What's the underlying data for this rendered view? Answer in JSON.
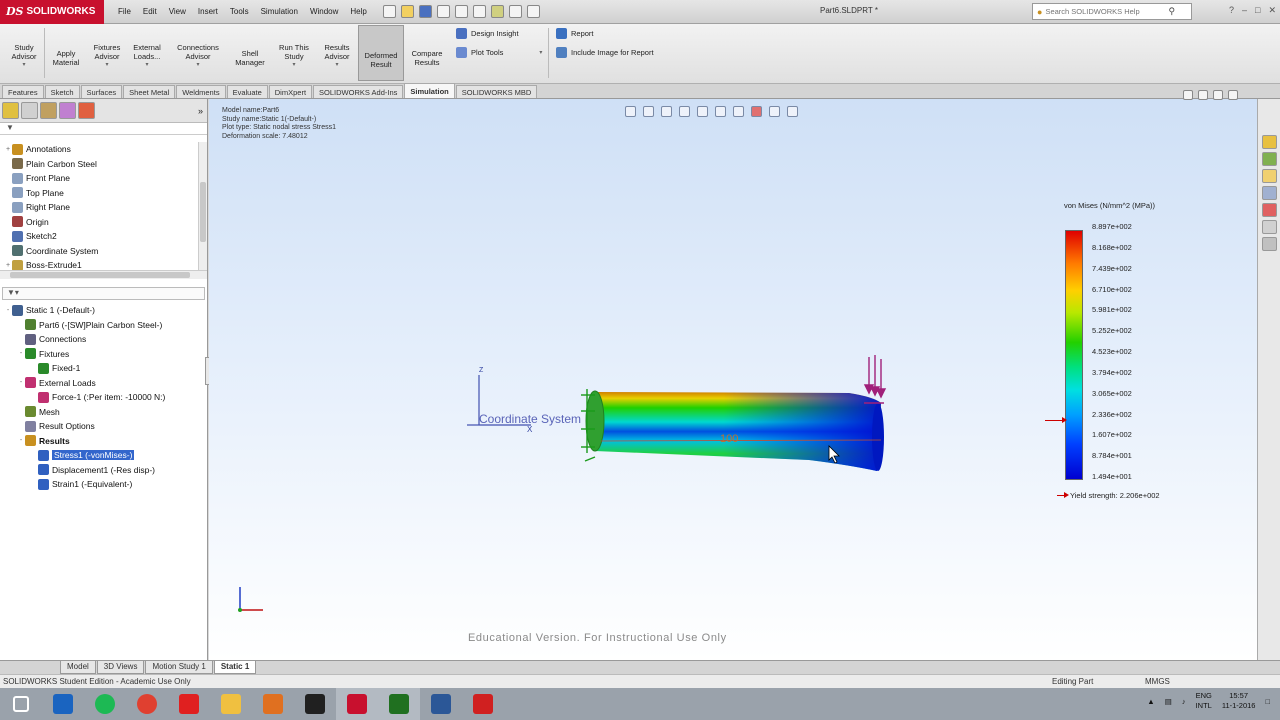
{
  "app": {
    "brand": "SOLIDWORKS",
    "brand_mark": "DS",
    "document_title": "Part6.SLDPRT *",
    "search_placeholder": "Search SOLIDWORKS Help"
  },
  "menu": [
    "File",
    "Edit",
    "View",
    "Insert",
    "Tools",
    "Simulation",
    "Window",
    "Help"
  ],
  "command_manager": {
    "buttons": [
      {
        "label": "Study\nAdvisor",
        "color": "#e0a020"
      },
      {
        "label": "Apply\nMaterial",
        "color": "#8a6a3a"
      },
      {
        "label": "Fixtures\nAdvisor",
        "color": "#2a8a2a"
      },
      {
        "label": "External\nLoads...",
        "color": "#c03070"
      },
      {
        "label": "Connections\nAdvisor",
        "color": "#4a6ab0"
      },
      {
        "label": "Shell\nManager",
        "color": "#3a9ad0"
      },
      {
        "label": "Run This\nStudy",
        "color": "#d04020"
      },
      {
        "label": "Results\nAdvisor",
        "color": "#2a8a8a"
      },
      {
        "label": "Deformed\nResult",
        "color": "#3060c0"
      },
      {
        "label": "Compare\nResults",
        "color": "#50a050"
      }
    ],
    "design_insight": "Design Insight",
    "plot_tools": "Plot Tools",
    "report": "Report",
    "include_image": "Include Image for Report"
  },
  "cm_tabs": [
    "Features",
    "Sketch",
    "Surfaces",
    "Sheet Metal",
    "Weldments",
    "Evaluate",
    "DimXpert",
    "SOLIDWORKS Add-Ins",
    "Simulation",
    "SOLIDWORKS MBD"
  ],
  "feature_tree": [
    {
      "label": "Annotations",
      "color": "#c89020",
      "twist": "+"
    },
    {
      "label": "Plain Carbon Steel",
      "color": "#7a6a4a",
      "twist": ""
    },
    {
      "label": "Front Plane",
      "color": "#8aa0c0",
      "twist": ""
    },
    {
      "label": "Top Plane",
      "color": "#8aa0c0",
      "twist": ""
    },
    {
      "label": "Right Plane",
      "color": "#8aa0c0",
      "twist": ""
    },
    {
      "label": "Origin",
      "color": "#a04040",
      "twist": ""
    },
    {
      "label": "Sketch2",
      "color": "#5070b0",
      "twist": ""
    },
    {
      "label": "Coordinate System",
      "color": "#507070",
      "twist": ""
    },
    {
      "label": "Boss-Extrude1",
      "color": "#c0a040",
      "twist": "+"
    }
  ],
  "sim_tree": [
    {
      "label": "Static 1 (-Default-)",
      "color": "#406090",
      "indent": 0,
      "twist": "-"
    },
    {
      "label": "Part6 (-[SW]Plain Carbon Steel-)",
      "color": "#508030",
      "indent": 1,
      "twist": ""
    },
    {
      "label": "Connections",
      "color": "#606080",
      "indent": 1,
      "twist": ""
    },
    {
      "label": "Fixtures",
      "color": "#2a8a2a",
      "indent": 1,
      "twist": "-"
    },
    {
      "label": "Fixed-1",
      "color": "#2a8a2a",
      "indent": 2,
      "twist": ""
    },
    {
      "label": "External Loads",
      "color": "#c03070",
      "indent": 1,
      "twist": "-"
    },
    {
      "label": "Force-1 (:Per item: -10000 N:)",
      "color": "#c03070",
      "indent": 2,
      "twist": ""
    },
    {
      "label": "Mesh",
      "color": "#6a8a30",
      "indent": 1,
      "twist": ""
    },
    {
      "label": "Result Options",
      "color": "#8080a0",
      "indent": 1,
      "twist": ""
    },
    {
      "label": "Results",
      "color": "#c89020",
      "indent": 1,
      "twist": "-",
      "bold": true
    },
    {
      "label": "Stress1 (-vonMises-)",
      "color": "#3060c0",
      "indent": 2,
      "twist": "",
      "selected": true
    },
    {
      "label": "Displacement1 (-Res disp-)",
      "color": "#3060c0",
      "indent": 2,
      "twist": ""
    },
    {
      "label": "Strain1 (-Equivalent-)",
      "color": "#3060c0",
      "indent": 2,
      "twist": ""
    }
  ],
  "plot_info": {
    "model_name": "Model name:Part6",
    "study_name": "Study name:Static 1(-Default-)",
    "plot_type": "Plot type: Static nodal stress Stress1",
    "deformation": "Deformation scale: 7.48012"
  },
  "legend": {
    "title": "von Mises (N/mm^2 (MPa))",
    "ticks": [
      "8.897e+002",
      "8.168e+002",
      "7.439e+002",
      "6.710e+002",
      "5.981e+002",
      "5.252e+002",
      "4.523e+002",
      "3.794e+002",
      "3.065e+002",
      "2.336e+002",
      "1.607e+002",
      "8.784e+001",
      "1.494e+001"
    ],
    "yield": "Yield strength: 2.206e+002",
    "colors": {
      "max": "#e00000",
      "min": "#0000d0"
    }
  },
  "viewport": {
    "coord_label": "Coordinate System",
    "dim_value": "100",
    "axis_z": "Z",
    "axis_x": "X",
    "watermark": "Educational Version. For Instructional Use Only"
  },
  "bottom_tabs": [
    "Model",
    "3D Views",
    "Motion Study 1",
    "Static 1"
  ],
  "status": {
    "left": "SOLIDWORKS Student Edition - Academic Use Only",
    "mode": "Editing Part",
    "units": "MMGS"
  },
  "taskbar": {
    "lang": "ENG",
    "region": "INTL",
    "time": "15:57",
    "date": "11-1-2016",
    "apps": [
      {
        "name": "windows-start",
        "color": "#ffffff"
      },
      {
        "name": "outlook",
        "color": "#1a64c0"
      },
      {
        "name": "spotify",
        "color": "#1db954"
      },
      {
        "name": "chrome",
        "color": "#e04030"
      },
      {
        "name": "redstar",
        "color": "#e02020"
      },
      {
        "name": "explorer",
        "color": "#f0c040"
      },
      {
        "name": "matlab",
        "color": "#e07020"
      },
      {
        "name": "xming",
        "color": "#202020"
      },
      {
        "name": "solidworks",
        "color": "#c8102e"
      },
      {
        "name": "plant",
        "color": "#207020"
      },
      {
        "name": "word",
        "color": "#2b5797"
      },
      {
        "name": "acrobat",
        "color": "#d02020"
      }
    ]
  }
}
